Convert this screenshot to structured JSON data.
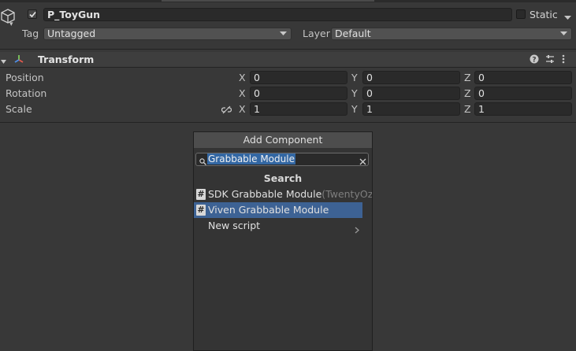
{
  "header": {
    "name": "P_ToyGun",
    "static_label": "Static",
    "tag_label": "Tag",
    "tag_value": "Untagged",
    "layer_label": "Layer",
    "layer_value": "Default"
  },
  "transform": {
    "title": "Transform",
    "rows": [
      {
        "label": "Position",
        "x": "0",
        "y": "0",
        "z": "0"
      },
      {
        "label": "Rotation",
        "x": "0",
        "y": "0",
        "z": "0"
      },
      {
        "label": "Scale",
        "x": "1",
        "y": "1",
        "z": "1"
      }
    ],
    "axis_labels": {
      "x": "X",
      "y": "Y",
      "z": "Z"
    }
  },
  "add_component": {
    "title": "Add Component",
    "search_value": "Grabbable Module",
    "search_header": "Search",
    "items": [
      {
        "label": "SDK Grabbable Module",
        "sub": "(TwentyOz.Vi",
        "selected": false
      },
      {
        "label": "Viven Grabbable Module",
        "sub": "",
        "selected": true
      }
    ],
    "new_script_label": "New script"
  },
  "colors": {
    "background": "#383838",
    "field": "#2a2a2a",
    "selection": "#3d6294",
    "text_selection": "#3367a3"
  },
  "icons": [
    "gameobject-cube-icon",
    "check-icon",
    "chevron-down-icon",
    "transform-axes-icon",
    "help-icon",
    "presets-icon",
    "kebab-menu-icon",
    "link-scale-icon",
    "search-icon",
    "clear-icon",
    "script-hash-icon",
    "chevron-right-icon"
  ]
}
